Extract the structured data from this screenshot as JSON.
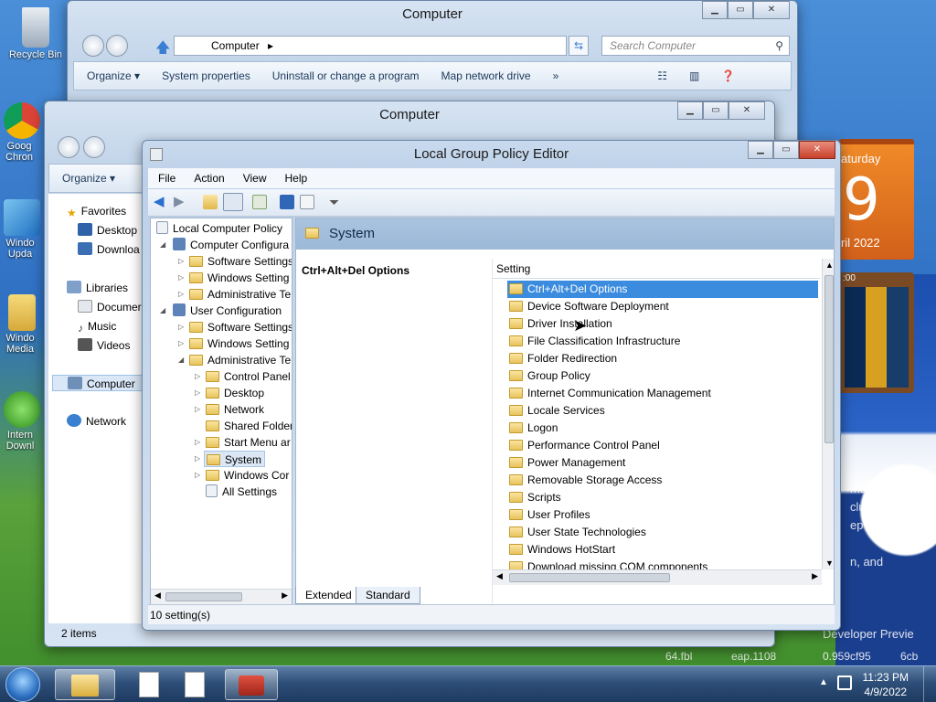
{
  "desktop": {
    "icons": [
      {
        "label": "Recycle Bin"
      },
      {
        "label": "Goog Chron"
      },
      {
        "label": "Windo Upda"
      },
      {
        "label": "Windo Media"
      },
      {
        "label": "Intern Downl"
      }
    ],
    "wallpaper_text": [
      "manner may",
      "cluding",
      "ep",
      "n, and",
      "Developer Previe",
      "64.fbl",
      "eap.1108",
      "0.959cf95",
      "6cb"
    ]
  },
  "gadgets": {
    "calendar": {
      "day_name": "aturday",
      "day": "9",
      "month_year": "ril 2022"
    },
    "clock": {
      "label": ":00"
    }
  },
  "explorer_back": {
    "title": "Computer",
    "address": "Computer",
    "search_placeholder": "Search Computer",
    "toolbar": [
      "Organize ▾",
      "System properties",
      "Uninstall or change a program",
      "Map network drive",
      "»"
    ]
  },
  "explorer_mid": {
    "title": "Computer",
    "organize": "Organize ▾",
    "nav": {
      "favorites": "Favorites",
      "desktop": "Desktop",
      "downloads": "Downloa",
      "libraries": "Libraries",
      "documents": "Documer",
      "music": "Music",
      "videos": "Videos",
      "computer": "Computer",
      "network": "Network"
    },
    "status": "2 items"
  },
  "gpedit": {
    "title": "Local Group Policy Editor",
    "menu": [
      "File",
      "Action",
      "View",
      "Help"
    ],
    "tree": {
      "root": "Local Computer Policy",
      "computer_config": "Computer Configura",
      "cc_software": "Software Settings",
      "cc_windows": "Windows Setting",
      "cc_admin": "Administrative Te",
      "user_config": "User Configuration",
      "uc_software": "Software Settings",
      "uc_windows": "Windows Setting",
      "uc_admin": "Administrative Te",
      "control_panel": "Control Panel",
      "desktop": "Desktop",
      "network": "Network",
      "shared_folders": "Shared Folder",
      "start_menu": "Start Menu ar",
      "system": "System",
      "windows_components": "Windows Cor",
      "all_settings": "All Settings"
    },
    "header": "System",
    "detail_title": "Ctrl+Alt+Del Options",
    "column_setting": "Setting",
    "items": [
      "Ctrl+Alt+Del Options",
      "Device Software Deployment",
      "Driver Installation",
      "File Classification Infrastructure",
      "Folder Redirection",
      "Group Policy",
      "Internet Communication Management",
      "Locale Services",
      "Logon",
      "Performance Control Panel",
      "Power Management",
      "Removable Storage Access",
      "Scripts",
      "User Profiles",
      "User State Technologies",
      "Windows HotStart",
      "Download missing COM components"
    ],
    "tabs": [
      "Extended",
      "Standard"
    ],
    "status": "10 setting(s)"
  },
  "taskbar": {
    "time": "11:23 PM",
    "date": "4/9/2022"
  }
}
